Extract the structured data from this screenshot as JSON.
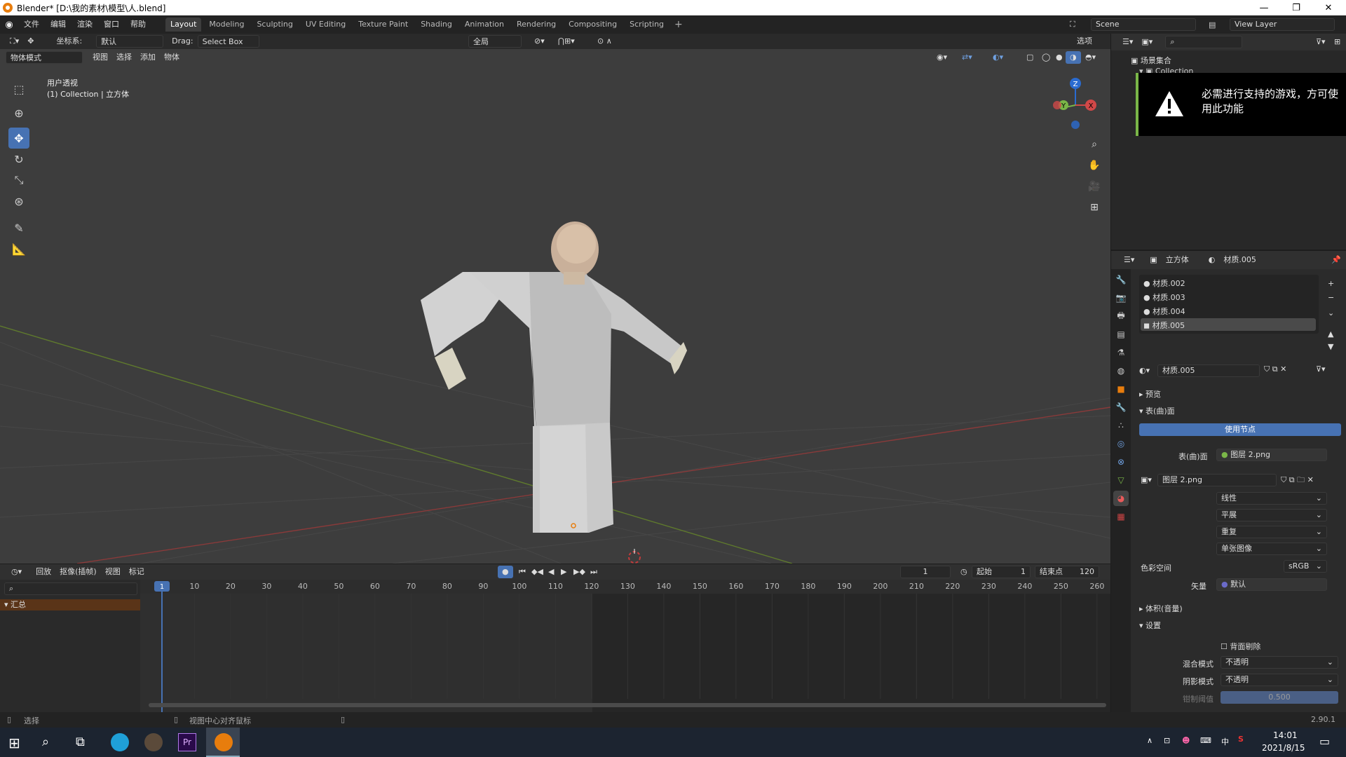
{
  "window": {
    "title": "Blender* [D:\\我的素材\\模型\\人.blend]"
  },
  "menu": [
    "文件",
    "编辑",
    "渲染",
    "窗口",
    "帮助"
  ],
  "workspaces": [
    "Layout",
    "Modeling",
    "Sculpting",
    "UV Editing",
    "Texture Paint",
    "Shading",
    "Animation",
    "Rendering",
    "Compositing",
    "Scripting"
  ],
  "active_workspace": "Layout",
  "scene": "Scene",
  "view_layer": "View Layer",
  "tool_header": {
    "orientation_label": "坐标系:",
    "orientation_value": "默认",
    "drag_label": "Drag:",
    "drag_value": "Select Box",
    "transform_pivot": "全局",
    "options": "选项"
  },
  "viewport_header": {
    "mode": "物体模式",
    "menus": [
      "视图",
      "选择",
      "添加",
      "物体"
    ]
  },
  "viewport_overlay": {
    "view_name": "用户透视",
    "collection_info": "(1) Collection | 立方体"
  },
  "gizmo": {
    "z": "Z",
    "y": "Y",
    "x": "X"
  },
  "outliner": {
    "title": "场景集合",
    "items": [
      "Collection"
    ]
  },
  "toast": {
    "message": "必需进行支持的游戏，方可使用此功能"
  },
  "properties": {
    "object_name": "立方体",
    "material_name": "材质.005",
    "material_slots": [
      "材质.002",
      "材质.003",
      "材质.004",
      "材质.005"
    ],
    "active_slot_index": 3,
    "material_field": "材质.005",
    "sections": {
      "preview": "预览",
      "surface": "表(曲)面",
      "volume": "体积(音量)",
      "settings": "设置"
    },
    "use_nodes": "使用节点",
    "surface_label": "表(曲)面",
    "surface_value": "图层 2.png",
    "image_name": "图层 2.png",
    "interpolation": "线性",
    "projection": "平展",
    "extension": "重复",
    "source": "单张图像",
    "color_space_label": "色彩空间",
    "color_space_value": "sRGB",
    "vector_label": "矢量",
    "vector_value": "默认",
    "backface_culling": "背面剔除",
    "blend_mode_label": "混合模式",
    "blend_mode_value": "不透明",
    "shadow_mode_label": "阴影模式",
    "shadow_mode_value": "不透明",
    "clip_threshold_label": "钳制阈值",
    "clip_threshold_value": "0.500"
  },
  "timeline": {
    "menus": [
      "回放",
      "抠像(插帧)",
      "视图",
      "标记"
    ],
    "current_frame": "1",
    "start_label": "起始",
    "start_value": "1",
    "end_label": "结束点",
    "end_value": "120",
    "ruler": [
      "1",
      "10",
      "20",
      "30",
      "40",
      "50",
      "60",
      "70",
      "80",
      "90",
      "100",
      "110",
      "120",
      "130",
      "140",
      "150",
      "160",
      "170",
      "180",
      "190",
      "200",
      "210",
      "220",
      "230",
      "240",
      "250",
      "260"
    ],
    "summary": "汇总"
  },
  "status": {
    "left": "选择",
    "middle": "视图中心对齐鼠标",
    "version": "2.90.1"
  },
  "taskbar": {
    "time": "14:01",
    "date": "2021/8/15",
    "ime": "中"
  }
}
